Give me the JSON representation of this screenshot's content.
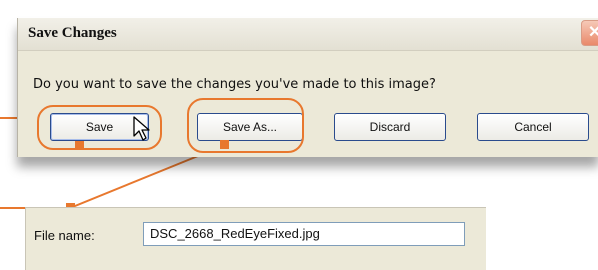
{
  "dialog": {
    "title": "Save Changes",
    "close_symbol": "✕",
    "message": "Do you want to save the changes you've made to this image?",
    "buttons": {
      "save": "Save",
      "save_as": "Save As...",
      "discard": "Discard",
      "cancel": "Cancel"
    }
  },
  "file_panel": {
    "label": "File name:",
    "value": "DSC_2668_RedEyeFixed.jpg"
  },
  "colors": {
    "highlight": "#e8782e",
    "dialog_bg": "#ece9d8",
    "button_border": "#2a4b8d"
  },
  "icons": {
    "cursor": "arrow-pointer-icon",
    "close": "close-icon"
  }
}
